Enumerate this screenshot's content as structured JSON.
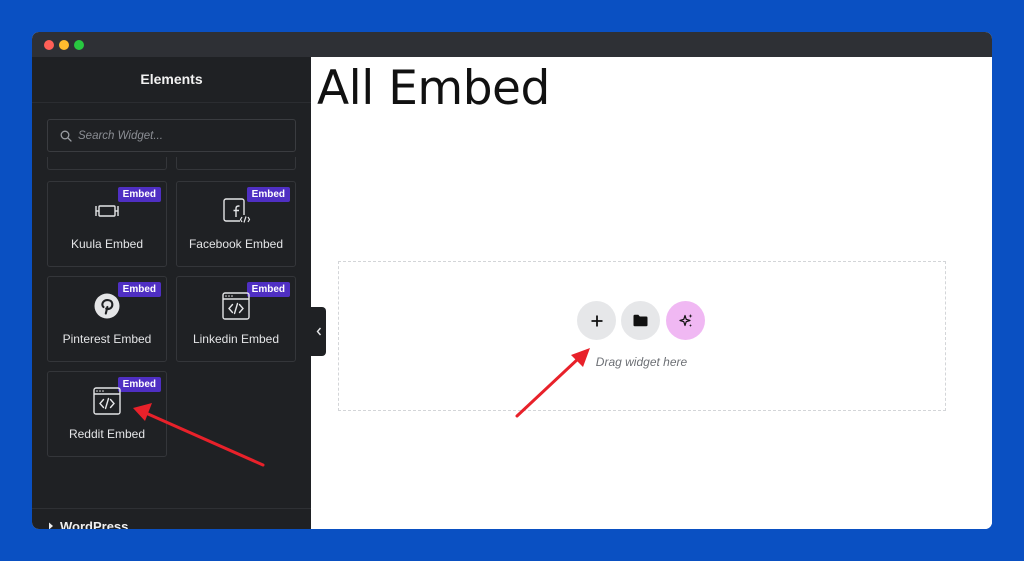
{
  "window": {
    "controls": [
      "close",
      "minimize",
      "maximize"
    ]
  },
  "sidebar": {
    "title": "Elements",
    "search": {
      "placeholder": "Search Widget...",
      "value": "",
      "icon": "search-icon"
    },
    "widgets": [
      {
        "label": "Kuula Embed",
        "badge": "Embed",
        "icon": "kuula-panorama-icon"
      },
      {
        "label": "Facebook Embed",
        "badge": "Embed",
        "icon": "facebook-embed-icon"
      },
      {
        "label": "Pinterest Embed",
        "badge": "Embed",
        "icon": "pinterest-icon"
      },
      {
        "label": "Linkedin Embed",
        "badge": "Embed",
        "icon": "code-window-icon"
      },
      {
        "label": "Reddit Embed",
        "badge": "Embed",
        "icon": "code-window-icon"
      }
    ],
    "category": {
      "label": "WordPress",
      "icon": "caret-right-icon"
    }
  },
  "canvas": {
    "page_title": "All Embed",
    "dropzone": {
      "hint": "Drag widget here",
      "buttons": [
        {
          "name": "add",
          "icon": "plus-icon"
        },
        {
          "name": "template-library",
          "icon": "folder-icon"
        },
        {
          "name": "ai-assistant",
          "icon": "sparkle-icon"
        }
      ]
    }
  },
  "colors": {
    "background": "#0a50c2",
    "sidebar": "#1f2124",
    "badge": "#4f2fc3",
    "ai_button": "#f0b8f3",
    "annotation_arrow": "#e8212a"
  }
}
